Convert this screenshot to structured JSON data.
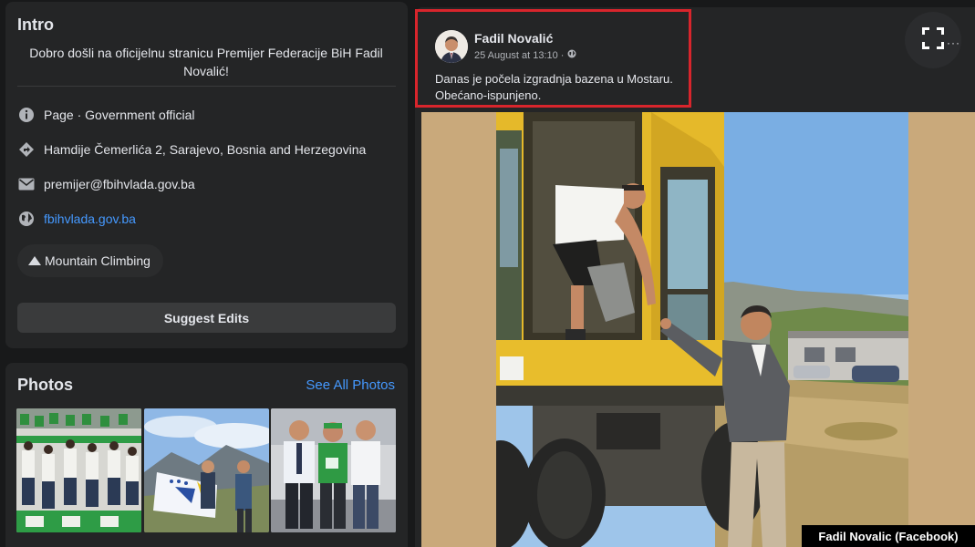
{
  "intro": {
    "title": "Intro",
    "bio": "Dobro došli na oficijelnu stranicu Premijer Federacije BiH Fadil Novalić!",
    "info": [
      {
        "icon": "info-icon",
        "text": "Page · Government official"
      },
      {
        "icon": "location-icon",
        "text": "Hamdije Čemerlića 2, Sarajevo, Bosnia and Herzegovina"
      },
      {
        "icon": "email-icon",
        "text": "premijer@fbihvlada.gov.ba"
      },
      {
        "icon": "globe-icon",
        "text": "fbihvlada.gov.ba"
      }
    ],
    "hobby": "Mountain Climbing",
    "suggest_edits": "Suggest Edits"
  },
  "photos": {
    "title": "Photos",
    "see_all": "See All Photos"
  },
  "post": {
    "author": "Fadil Novalić",
    "time": "25 August at 13:10 ·",
    "text": "Danas je počela izgradnja bazena u Mostaru. Obećano-ispunjeno.",
    "more": "···"
  },
  "credit": "Fadil Novalic (Facebook)",
  "colors": {
    "background": "#18191a",
    "card": "#242526",
    "link": "#4599ff",
    "highlight": "#d8252c"
  }
}
